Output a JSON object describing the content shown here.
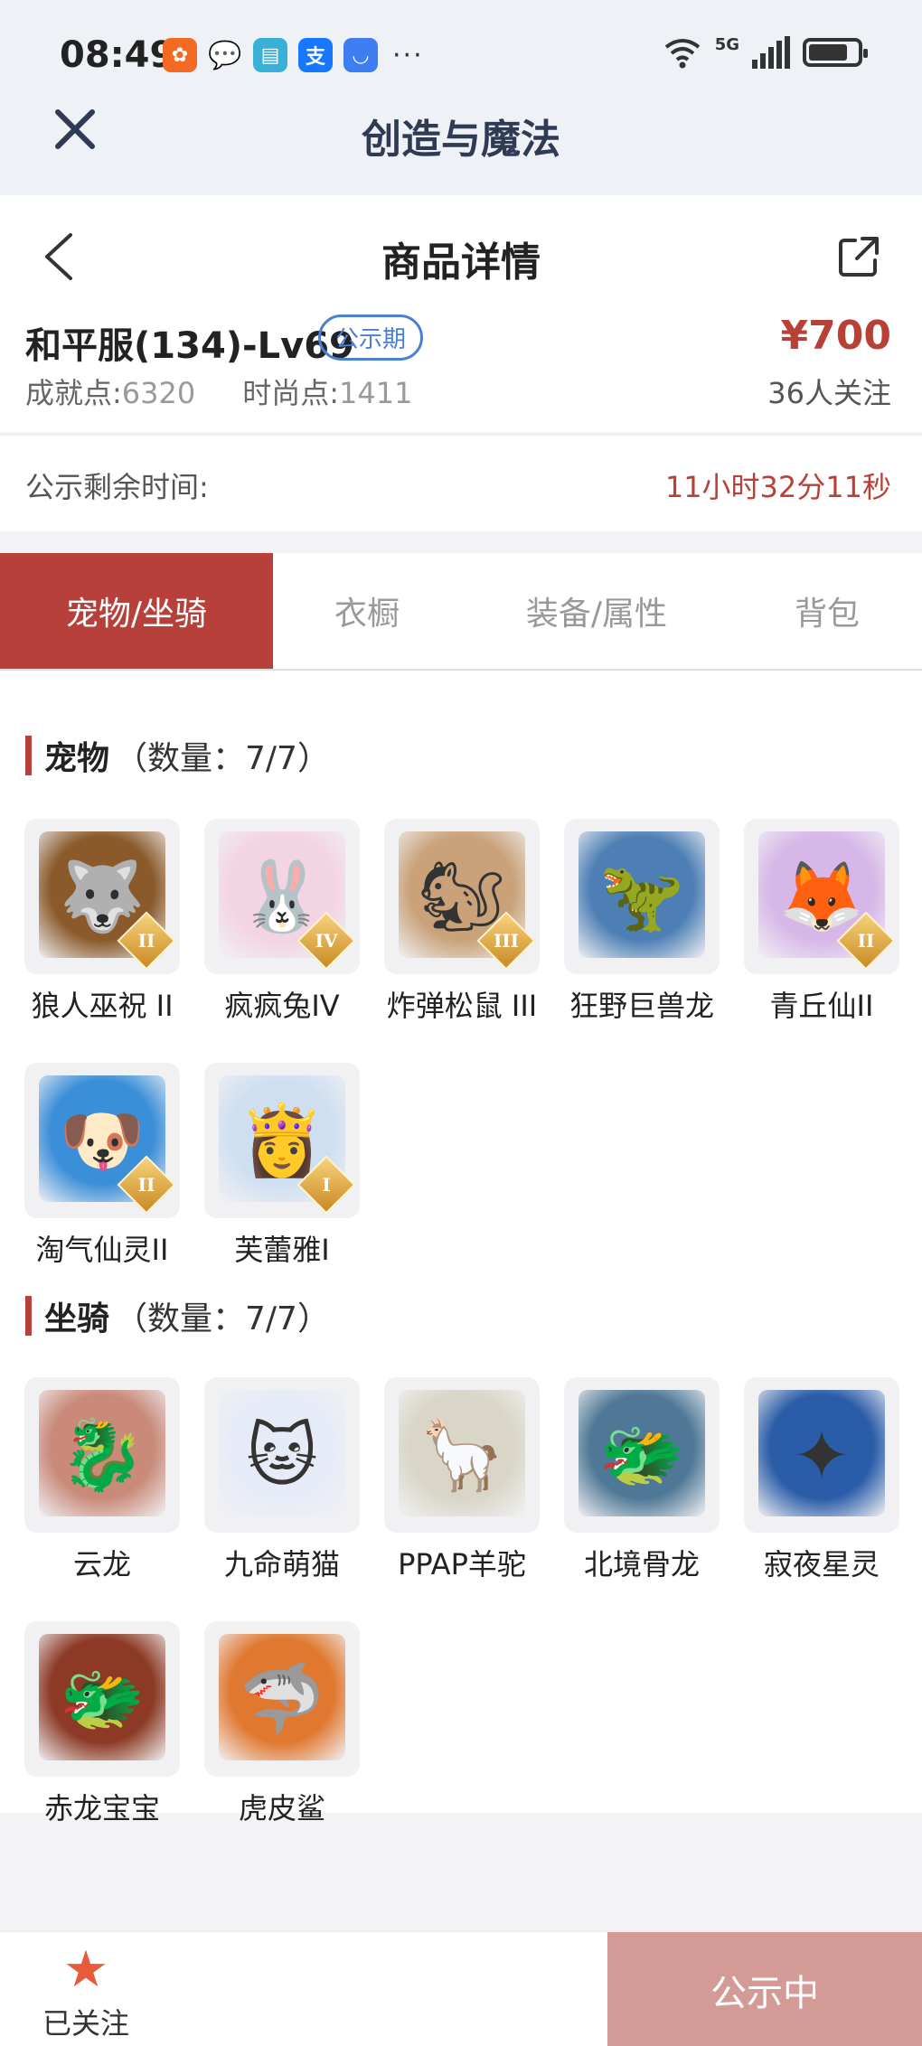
{
  "status_bar": {
    "time": "08:49",
    "network": "5G",
    "notification_icons": [
      "huaban-icon",
      "wechat-icon",
      "reader-icon",
      "alipay-icon",
      "honor-icon"
    ]
  },
  "app_header": {
    "title": "创造与魔法"
  },
  "product": {
    "page_title": "商品详情",
    "server": "和平服(134)-Lv69",
    "badge": "公示期",
    "price": "¥700",
    "achievement_label": "成就点:",
    "achievement_value": "6320",
    "fashion_label": "时尚点:",
    "fashion_value": "1411",
    "followers": "36人关注",
    "remaining_label": "公示剩余时间:",
    "remaining_value": "11小时32分11秒"
  },
  "tabs": [
    {
      "label": "宠物/坐骑",
      "active": true
    },
    {
      "label": "衣橱",
      "active": false
    },
    {
      "label": "装备/属性",
      "active": false
    },
    {
      "label": "背包",
      "active": false
    }
  ],
  "pets": {
    "title": "宠物",
    "count": "（数量：7/7）",
    "items": [
      {
        "name": "狼人巫祝 II",
        "rank": "II",
        "icon": "wolf-icon",
        "color": "#8a5a2b"
      },
      {
        "name": "疯疯兔IV",
        "rank": "IV",
        "icon": "rabbit-icon",
        "color": "#f3d4e2"
      },
      {
        "name": "炸弹松鼠 III",
        "rank": "III",
        "icon": "squirrel-icon",
        "color": "#c9a27a"
      },
      {
        "name": "狂野巨兽龙",
        "rank": "",
        "icon": "dinosaur-icon",
        "color": "#4d7fb5"
      },
      {
        "name": "青丘仙II",
        "rank": "II",
        "icon": "fox-fairy-icon",
        "color": "#d7b7e8"
      },
      {
        "name": "淘气仙灵II",
        "rank": "II",
        "icon": "puppy-icon",
        "color": "#3b8ed8"
      },
      {
        "name": "芙蕾雅I",
        "rank": "I",
        "icon": "goddess-icon",
        "color": "#cfdff2"
      }
    ]
  },
  "mounts": {
    "title": "坐骑",
    "count": "（数量：7/7）",
    "items": [
      {
        "name": "云龙",
        "icon": "dragon-icon",
        "color": "#c98a7a"
      },
      {
        "name": "九命萌猫",
        "icon": "cat-icon",
        "color": "#e6ecf7"
      },
      {
        "name": "PPAP羊驼",
        "icon": "alpaca-icon",
        "color": "#d9d5c7"
      },
      {
        "name": "北境骨龙",
        "icon": "bone-dragon-icon",
        "color": "#4f7896"
      },
      {
        "name": "寂夜星灵",
        "icon": "star-spirit-icon",
        "color": "#2a5ca8"
      },
      {
        "name": "赤龙宝宝",
        "icon": "baby-dragon-icon",
        "color": "#8c3a25"
      },
      {
        "name": "虎皮鲨",
        "icon": "shark-icon",
        "color": "#e0782f"
      }
    ]
  },
  "bottom_bar": {
    "follow_label": "已关注",
    "status_button": "公示中"
  }
}
